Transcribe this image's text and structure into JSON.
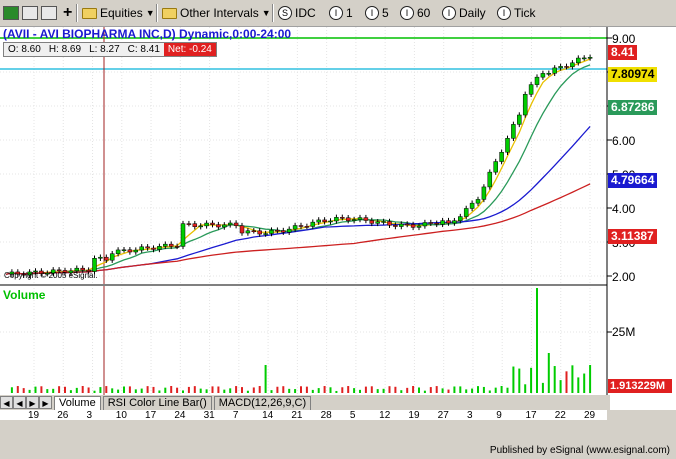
{
  "toolbar": {
    "equities": "Equities",
    "other_intervals": "Other Intervals",
    "idc": "IDC",
    "i1": "1",
    "i5": "5",
    "i60": "60",
    "daily": "Daily",
    "tick": "Tick",
    "circle_letters": [
      "S",
      "I",
      "I",
      "I",
      "I",
      "I"
    ]
  },
  "chart": {
    "title": "(AVII - AVI BIOPHARMA INC,D) Dynamic,0:00-24:00",
    "ohlc": {
      "o": "O: 8.60",
      "h": "H: 8.69",
      "l": "L: 8.27",
      "c": "C: 8.41",
      "net": "Net: -0.24"
    },
    "copyright": "Copyright © 2005 eSignal.",
    "price_ticks": [
      "9.00",
      "8.00",
      "7.00",
      "6.00",
      "5.00",
      "4.00",
      "3.00",
      "2.00"
    ],
    "price_tags": [
      {
        "text": "8.41",
        "bg": "#e02020",
        "fg": "#ffffff"
      },
      {
        "text": "7.80974",
        "bg": "#f0e000",
        "fg": "#000000"
      },
      {
        "text": "6.87286",
        "bg": "#2a9a5a",
        "fg": "#ffffff"
      },
      {
        "text": "4.79664",
        "bg": "#1a1ad0",
        "fg": "#ffffff"
      },
      {
        "text": "3.11387",
        "bg": "#e02020",
        "fg": "#ffffff"
      }
    ],
    "volume_label": "Volume",
    "volume_tick": "25M",
    "volume_tag": {
      "text": "1.913229M",
      "bg": "#e02020",
      "fg": "#ffffff"
    },
    "date_ticks": [
      "19",
      "26",
      "3",
      "10",
      "17",
      "24",
      "31",
      "7",
      "14",
      "21",
      "28",
      "5",
      "12",
      "19",
      "27",
      "3",
      "9",
      "17",
      "22",
      "29"
    ],
    "colors": {
      "up": "#00cc00",
      "down": "#e02020",
      "ma_yellow": "#e8c000",
      "ma_green": "#2a9a5a",
      "ma_blue": "#1a1ad0",
      "ma_red": "#cc2020",
      "green_line": "#00c000",
      "cyan_line": "#30c0e0",
      "title": "#1a1ad0"
    }
  },
  "tabs": {
    "items": [
      "Volume",
      "RSI Color Line Bar()",
      "MACD(12,26,9,C)"
    ]
  },
  "published": "Published by eSignal (www.esignal.com)"
}
